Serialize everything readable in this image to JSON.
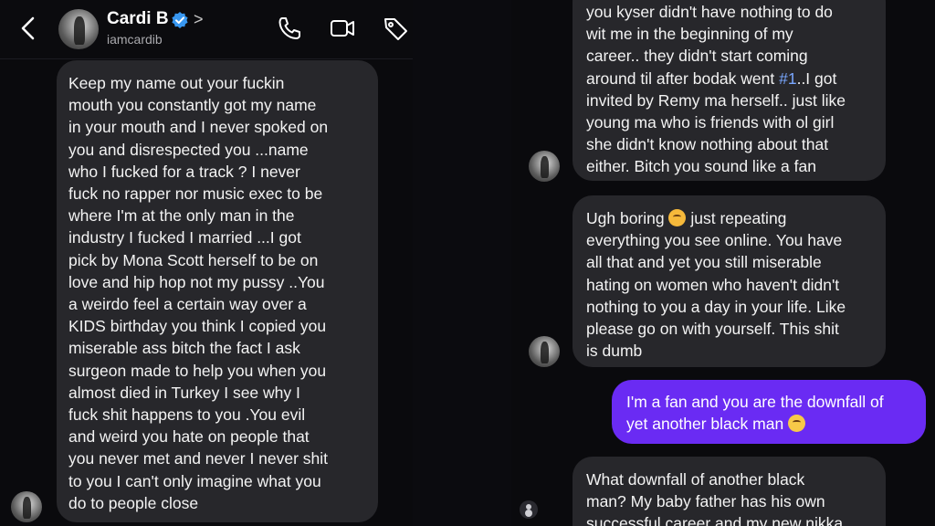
{
  "header": {
    "name": "Cardi B",
    "handle": "iamcardib",
    "chevron": ">"
  },
  "icons": {
    "back": "chevron-left-icon",
    "verified": "verified-badge-icon",
    "call": "phone-icon",
    "video": "video-camera-icon",
    "tag": "tag-icon"
  },
  "colors": {
    "background": "#0a0a0d",
    "incoming_bubble": "#27272b",
    "outgoing_bubble": "#6a2bf3",
    "verified": "#3897f0"
  },
  "left_thread": {
    "message": "Keep my name out your fuckin\nmouth you constantly got my name\nin your mouth and I never spoked on\nyou and disrespected you ...name\nwho I fucked for a track ? I never\nfuck no rapper nor music exec to be\nwhere I'm at the only man in the\nindustry I fucked I married ...I got\npick by Mona Scott herself to be on\nlove and hip hop not my pussy ..You\na weirdo feel a certain way over a\nKIDS birthday you think I copied you\nmiserable ass bitch the fact I ask\nsurgeon made to help you when you\nalmost died in Turkey I see why I\nfuck shit happens to you .You evil\nand weird you hate on people that\nyou never met and never I never shit\nto you I can't only imagine what you\ndo to people close"
  },
  "right_thread": {
    "msg1_before": "you kyser didn't have nothing to do\nwit me in the beginning of my\ncareer.. they didn't start coming\naround til after bodak went ",
    "msg1_link": "#1",
    "msg1_after": "..I got\ninvited by Remy ma herself.. just like\nyoung ma who is friends with ol girl\nshe didn't know nothing about that\neither. Bitch you sound like a fan",
    "msg2_before": "Ugh boring ",
    "msg2_after": " just repeating\neverything you see online. You have\nall that and yet you still miserable\nhating on women who haven't didn't\nnothing to you a day in your life. Like\nplease go on with yourself. This shit\nis dumb",
    "msg3": "I'm a fan and you are the downfall of\nyet another black man ",
    "msg4": "What downfall of another black\nman? My baby father has his own\nsuccessful career and my new nikka"
  }
}
